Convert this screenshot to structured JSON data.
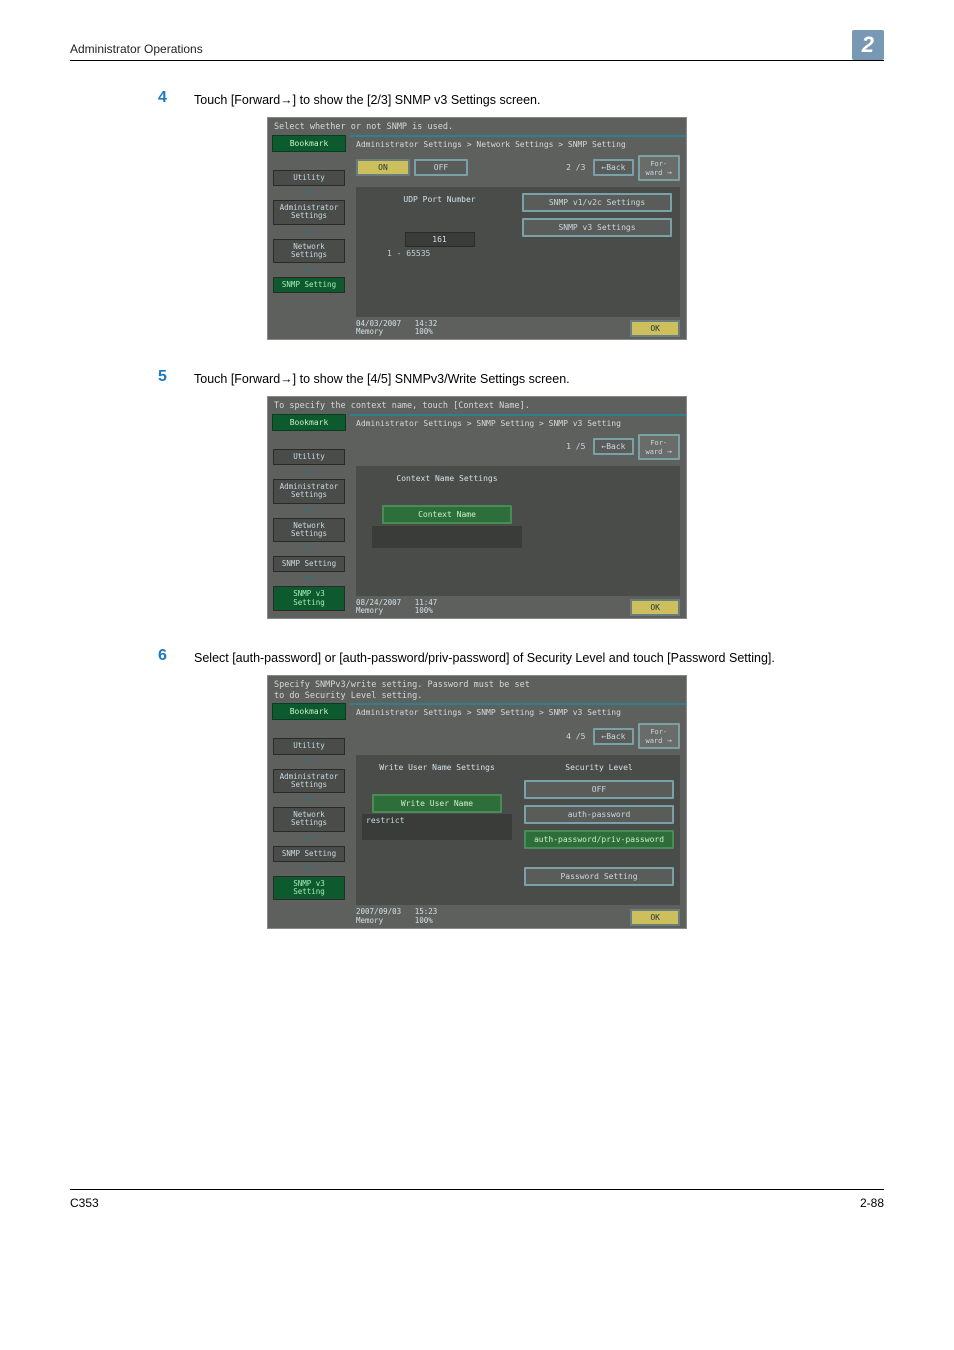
{
  "header": {
    "title": "Administrator Operations",
    "chapter": "2"
  },
  "steps": {
    "s4": {
      "num": "4",
      "text": "Touch [Forward→] to show the [2/3] SNMP v3 Settings screen."
    },
    "s5": {
      "num": "5",
      "text": "Touch [Forward→] to show the [4/5] SNMPv3/Write Settings screen."
    },
    "s6": {
      "num": "6",
      "text": "Select [auth-password] or [auth-password/priv-password] of Security Level and touch [Password Setting]."
    }
  },
  "screen1": {
    "top": "Select whether or not SNMP is used.",
    "bookmark": "Bookmark",
    "sidebar": [
      "Utility",
      "Administrator Settings",
      "Network Settings",
      "SNMP Setting"
    ],
    "breadcrumb": "Administrator Settings > Network Settings > SNMP Setting",
    "on": "ON",
    "off": "OFF",
    "page": "2 /3",
    "back": "←Back",
    "fwd": "Forward →",
    "udp_label": "UDP Port Number",
    "udp_value": "161",
    "udp_range": "1  -  65535",
    "btn_v1v2c": "SNMP v1/v2c Settings",
    "btn_v3": "SNMP v3 Settings",
    "date": "04/03/2007",
    "time": "14:32",
    "mem": "Memory",
    "memv": "100%",
    "ok": "OK"
  },
  "screen2": {
    "top": "To specify the context name, touch [Context Name].",
    "bookmark": "Bookmark",
    "sidebar": [
      "Utility",
      "Administrator Settings",
      "Network Settings",
      "SNMP Setting",
      "SNMP v3 Setting"
    ],
    "breadcrumb": "Administrator Settings > SNMP Setting > SNMP v3 Setting",
    "page": "1 /5",
    "back": "←Back",
    "fwd": "Forward →",
    "group_label": "Context Name Settings",
    "btn_ctx": "Context Name",
    "date": "08/24/2007",
    "time": "11:47",
    "mem": "Memory",
    "memv": "100%",
    "ok": "OK"
  },
  "screen3": {
    "top": "Specify SNMPv3/write setting. Password must be set\nto do Security Level setting.",
    "bookmark": "Bookmark",
    "sidebar": [
      "Utility",
      "Administrator Settings",
      "Network Settings",
      "SNMP Setting",
      "SNMP v3 Setting"
    ],
    "breadcrumb": "Administrator Settings > SNMP Setting > SNMP v3 Setting",
    "page": "4 /5",
    "back": "←Back",
    "fwd": "Forward →",
    "left_head": "Write User Name Settings",
    "right_head": "Security Level",
    "btn_wun": "Write User Name",
    "wun_value": "restrict",
    "lvl_off": "OFF",
    "lvl_auth": "auth-password",
    "lvl_authpriv": "auth-password/priv-password",
    "btn_pw": "Password Setting",
    "date": "2007/09/03",
    "time": "15:23",
    "mem": "Memory",
    "memv": "100%",
    "ok": "OK"
  },
  "footer": {
    "left": "C353",
    "right": "2-88"
  }
}
